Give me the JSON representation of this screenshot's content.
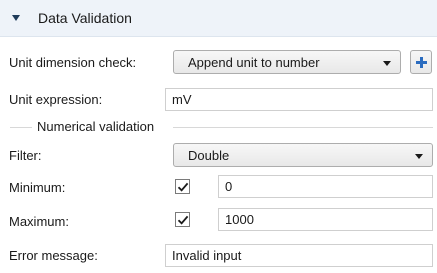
{
  "section": {
    "title": "Data Validation",
    "toggle_icon": "collapse-arrow-icon"
  },
  "unit_dimension_check": {
    "label": "Unit dimension check:",
    "value": "Append unit to number",
    "add_icon": "plus-icon",
    "add_color": "#2b6cbf"
  },
  "unit_expression": {
    "label": "Unit expression:",
    "value": "mV"
  },
  "numerical_validation": {
    "title": "Numerical validation"
  },
  "filter": {
    "label": "Filter:",
    "value": "Double"
  },
  "minimum": {
    "label": "Minimum:",
    "checked": true,
    "value": "0"
  },
  "maximum": {
    "label": "Maximum:",
    "checked": true,
    "value": "1000"
  },
  "error_message": {
    "label": "Error message:",
    "value": "Invalid input"
  },
  "colors": {
    "header_bg": "#eef3f9",
    "accent": "#2b6cbf"
  }
}
